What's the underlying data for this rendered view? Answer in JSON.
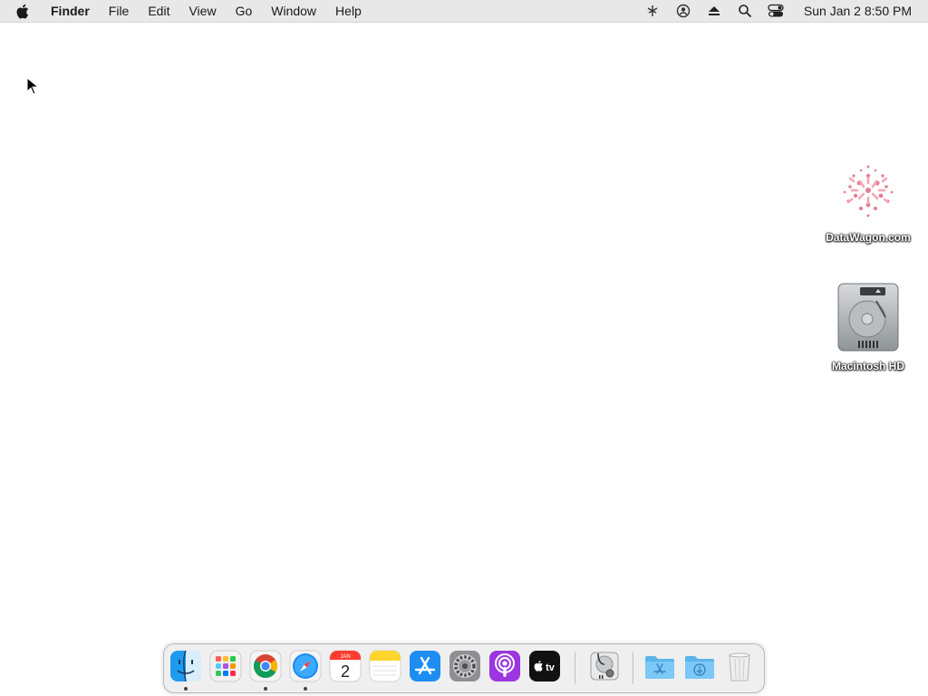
{
  "menubar": {
    "apple_icon": "apple-logo-icon",
    "menus": [
      "Finder",
      "File",
      "Edit",
      "View",
      "Go",
      "Window",
      "Help"
    ],
    "status_icons": [
      "network-icon",
      "user-account-icon",
      "eject-icon",
      "spotlight-search-icon",
      "control-center-icon"
    ],
    "clock": "Sun Jan 2  8:50 PM"
  },
  "desktop": {
    "icons": [
      {
        "label": "DataWagon.com",
        "icon": "pink-pattern-icon"
      },
      {
        "label": "Macintosh HD",
        "icon": "hard-drive-icon"
      }
    ]
  },
  "dock": {
    "apps": [
      {
        "name": "Finder",
        "running": true
      },
      {
        "name": "Launchpad",
        "running": false
      },
      {
        "name": "Google Chrome",
        "running": true
      },
      {
        "name": "Safari",
        "running": true
      },
      {
        "name": "Calendar",
        "running": false,
        "month": "JAN",
        "day": "2"
      },
      {
        "name": "Notes",
        "running": false
      },
      {
        "name": "App Store",
        "running": false
      },
      {
        "name": "System Preferences",
        "running": false
      },
      {
        "name": "Podcasts",
        "running": false
      },
      {
        "name": "TV",
        "running": false,
        "glyph": "tv"
      },
      {
        "name": "Disk Utility",
        "running": false
      },
      {
        "name": "Applications",
        "running": false
      },
      {
        "name": "Downloads",
        "running": false
      },
      {
        "name": "Trash",
        "running": false
      }
    ]
  }
}
